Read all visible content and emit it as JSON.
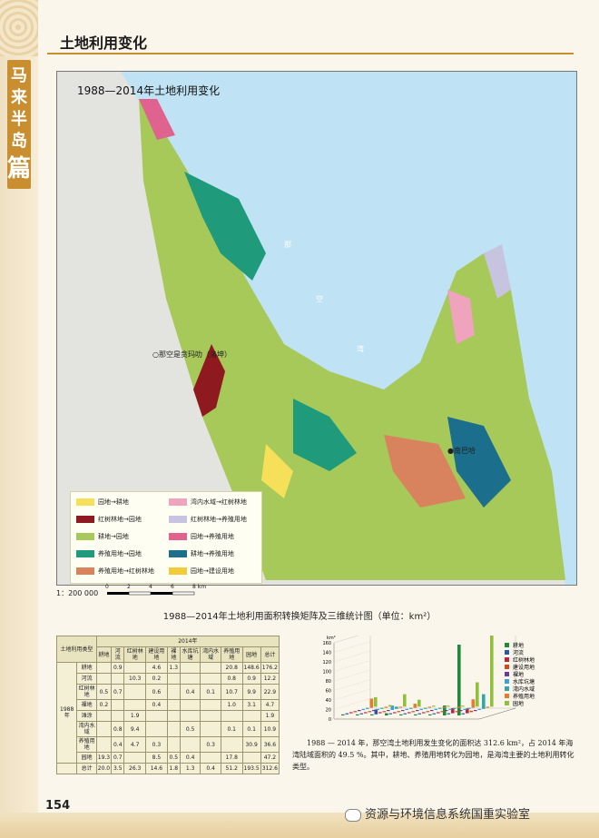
{
  "side": {
    "chars": [
      "马",
      "来",
      "半",
      "岛"
    ],
    "big": "篇"
  },
  "header": {
    "title": "土地利用变化"
  },
  "map": {
    "title": "1988—2014年土地利用变化",
    "labels": {
      "bay1": "那",
      "bay2": "空",
      "bay3": "湾",
      "city1": "○那空是贪玛叻（洛坤）",
      "city2": "●南巴哈"
    },
    "legend": [
      {
        "label": "园地→耕地",
        "color": "#f6e05a"
      },
      {
        "label": "湾内水域→红树林地",
        "color": "#f0a3bd"
      },
      {
        "label": "红树林地→园地",
        "color": "#8e1a1f"
      },
      {
        "label": "红树林地→养殖用地",
        "color": "#c7c4e0"
      },
      {
        "label": "耕地→园地",
        "color": "#a6c95a"
      },
      {
        "label": "园地→养殖用地",
        "color": "#e0628f"
      },
      {
        "label": "养殖用地→园地",
        "color": "#1f9a7a"
      },
      {
        "label": "耕地→养殖用地",
        "color": "#1b6f8c"
      },
      {
        "label": "养殖用地→红树林地",
        "color": "#d9835e"
      },
      {
        "label": "园地→建设用地",
        "color": "#f2cb3b"
      }
    ]
  },
  "scale": {
    "ratio": "1：200 000",
    "ticks": [
      "0",
      "2",
      "4",
      "6",
      "8 km"
    ]
  },
  "section": {
    "title": "1988—2014年土地利用面积转换矩阵及三维统计图（单位：km²）"
  },
  "matrix": {
    "corner": "土地利用类型",
    "year_top": "2014年",
    "year_side": "1988年",
    "cols": [
      "耕地",
      "河流",
      "红树林地",
      "建设用地",
      "裸地",
      "水库坑塘",
      "湾内水域",
      "养殖用地",
      "园地",
      "总计"
    ],
    "rows": [
      {
        "name": "耕地",
        "cells": [
          "",
          "0.9",
          "",
          "4.6",
          "1.3",
          "",
          "",
          "20.8",
          "148.6",
          "176.2"
        ]
      },
      {
        "name": "河流",
        "cells": [
          "",
          "",
          "10.3",
          "0.2",
          "",
          "",
          "",
          "0.8",
          "0.9",
          "12.2"
        ]
      },
      {
        "name": "红树林地",
        "cells": [
          "0.5",
          "0.7",
          "",
          "0.6",
          "",
          "0.4",
          "0.1",
          "10.7",
          "9.9",
          "22.9"
        ]
      },
      {
        "name": "裸地",
        "cells": [
          "0.2",
          "",
          "",
          "0.4",
          "",
          "",
          "",
          "1.0",
          "3.1",
          "4.7"
        ]
      },
      {
        "name": "滩涂",
        "cells": [
          "",
          "",
          "1.9",
          "",
          "",
          "",
          "",
          "",
          "",
          "1.9"
        ]
      },
      {
        "name": "湾内水域",
        "cells": [
          "",
          "0.8",
          "9.4",
          "",
          "",
          "0.5",
          "",
          "0.1",
          "0.1",
          "10.9"
        ]
      },
      {
        "name": "养殖用地",
        "cells": [
          "",
          "0.4",
          "4.7",
          "0.3",
          "",
          "",
          "0.3",
          "",
          "30.9",
          "36.6"
        ]
      },
      {
        "name": "园地",
        "cells": [
          "19.3",
          "0.7",
          "",
          "8.5",
          "0.5",
          "0.4",
          "",
          "17.8",
          "",
          "47.2"
        ]
      },
      {
        "name": "总计",
        "cells": [
          "20.0",
          "3.5",
          "26.3",
          "14.6",
          "1.8",
          "1.3",
          "0.4",
          "51.2",
          "193.5",
          "312.6"
        ]
      }
    ]
  },
  "chart_data": {
    "type": "bar",
    "title": "",
    "ylabel": "km²",
    "ylim": [
      0,
      160
    ],
    "yticks": [
      "0",
      "20",
      "40",
      "60",
      "80",
      "100",
      "120",
      "140",
      "160"
    ],
    "categories": [
      "耕地",
      "河流",
      "红树林地",
      "建设用地",
      "裸地",
      "水库坑塘",
      "湾内水域",
      "养殖用地",
      "园地"
    ],
    "series": [
      {
        "name": "耕地",
        "color": "#1f8a3a",
        "values": [
          0,
          0.9,
          0,
          4.6,
          1.3,
          0,
          0,
          20.8,
          148.6
        ]
      },
      {
        "name": "河流",
        "color": "#2b56a6",
        "values": [
          0,
          0,
          10.3,
          0.2,
          0,
          0,
          0,
          0.8,
          0.9
        ]
      },
      {
        "name": "红树林地",
        "color": "#c0243d",
        "values": [
          0.5,
          0.7,
          0,
          0.6,
          0,
          0.4,
          0.1,
          10.7,
          9.9
        ]
      },
      {
        "name": "建设用地",
        "color": "#d04a1e",
        "values": [
          0.2,
          0,
          0,
          0.4,
          0,
          0,
          0,
          1.0,
          3.1
        ]
      },
      {
        "name": "裸地",
        "color": "#6a3d9a",
        "values": [
          0,
          0,
          1.9,
          0,
          0,
          0,
          0,
          0,
          0
        ]
      },
      {
        "name": "水库坑塘",
        "color": "#3fa0d8",
        "values": [
          0,
          0.8,
          9.4,
          0,
          0,
          0.5,
          0,
          0.1,
          0.1
        ]
      },
      {
        "name": "湾内水域",
        "color": "#2ea8a8",
        "values": [
          0,
          0.4,
          4.7,
          0.3,
          0,
          0,
          0.3,
          0,
          30.9
        ]
      },
      {
        "name": "养殖用地",
        "color": "#e87a2a",
        "values": [
          19.3,
          0.7,
          0,
          8.5,
          0.5,
          0.4,
          0,
          17.8,
          0
        ]
      },
      {
        "name": "园地",
        "color": "#8fbf3c",
        "values": [
          20.0,
          3.5,
          26.3,
          14.6,
          1.8,
          1.3,
          0.4,
          51.2,
          193.5
        ]
      }
    ]
  },
  "paragraph": "1988 — 2014 年，那空湾土地利用发生变化的面积达 312.6 km²，占 2014 年海湾陆域面积的 49.5 %。其中，耕地、养殖用地转化为园地，是海湾主要的土地利用转化类型。",
  "page_number": "154",
  "watermark": "资源与环境信息系统国重实验室"
}
